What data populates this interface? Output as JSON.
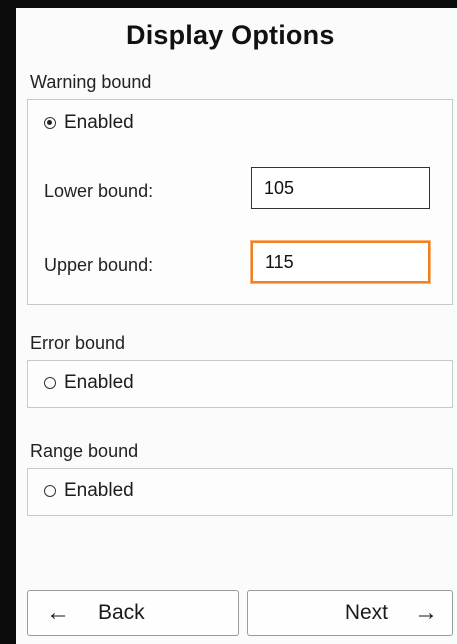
{
  "title": "Display Options",
  "warning": {
    "label": "Warning bound",
    "enabled_label": "Enabled",
    "enabled": true,
    "lower_label": "Lower bound:",
    "lower_value": "105",
    "upper_label": "Upper bound:",
    "upper_value": "115"
  },
  "error": {
    "label": "Error bound",
    "enabled_label": "Enabled",
    "enabled": false
  },
  "range": {
    "label": "Range bound",
    "enabled_label": "Enabled",
    "enabled": false
  },
  "nav": {
    "back_label": "Back",
    "next_label": "Next",
    "back_icon": "arrow-left-icon",
    "next_icon": "arrow-right-icon"
  },
  "colors": {
    "focus_border": "#f08020"
  }
}
